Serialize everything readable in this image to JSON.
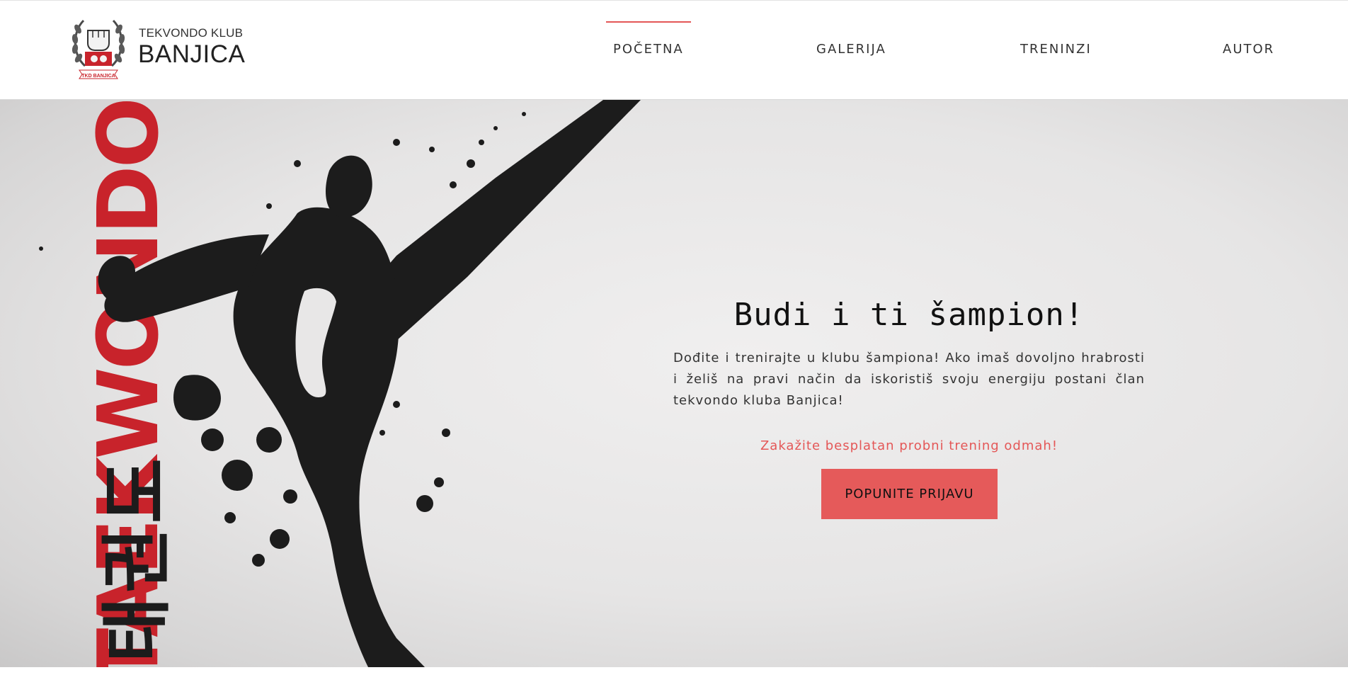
{
  "header": {
    "logo_icon": "tkd-banjica-logo",
    "logo_caption": "TKD BANJICA",
    "brand_small": "TEKVONDO KLUB",
    "brand_big": "BANJICA",
    "nav": [
      {
        "label": "POČETNA",
        "active": true
      },
      {
        "label": "GALERIJA",
        "active": false
      },
      {
        "label": "TRENINZI",
        "active": false
      },
      {
        "label": "AUTOR",
        "active": false
      }
    ]
  },
  "hero": {
    "art_text": "TAEKWONDO",
    "art_hangul": "태권도",
    "title": "Budi i ti šampion!",
    "text": "Dođite i trenirajte u klubu šampiona! Ako imaš dovoljno hrabrosti i želiš na pravi način da iskoristiš svoju energiju postani član tekvondo kluba Banjica!",
    "cta_text": "Zakažite besplatan probni trening odmah!",
    "button_label": "POPUNITE PRIJAVU"
  },
  "colors": {
    "accent": "#e45757",
    "button": "#e55a5a",
    "art_red": "#c8232b",
    "art_black": "#1c1c1c"
  }
}
